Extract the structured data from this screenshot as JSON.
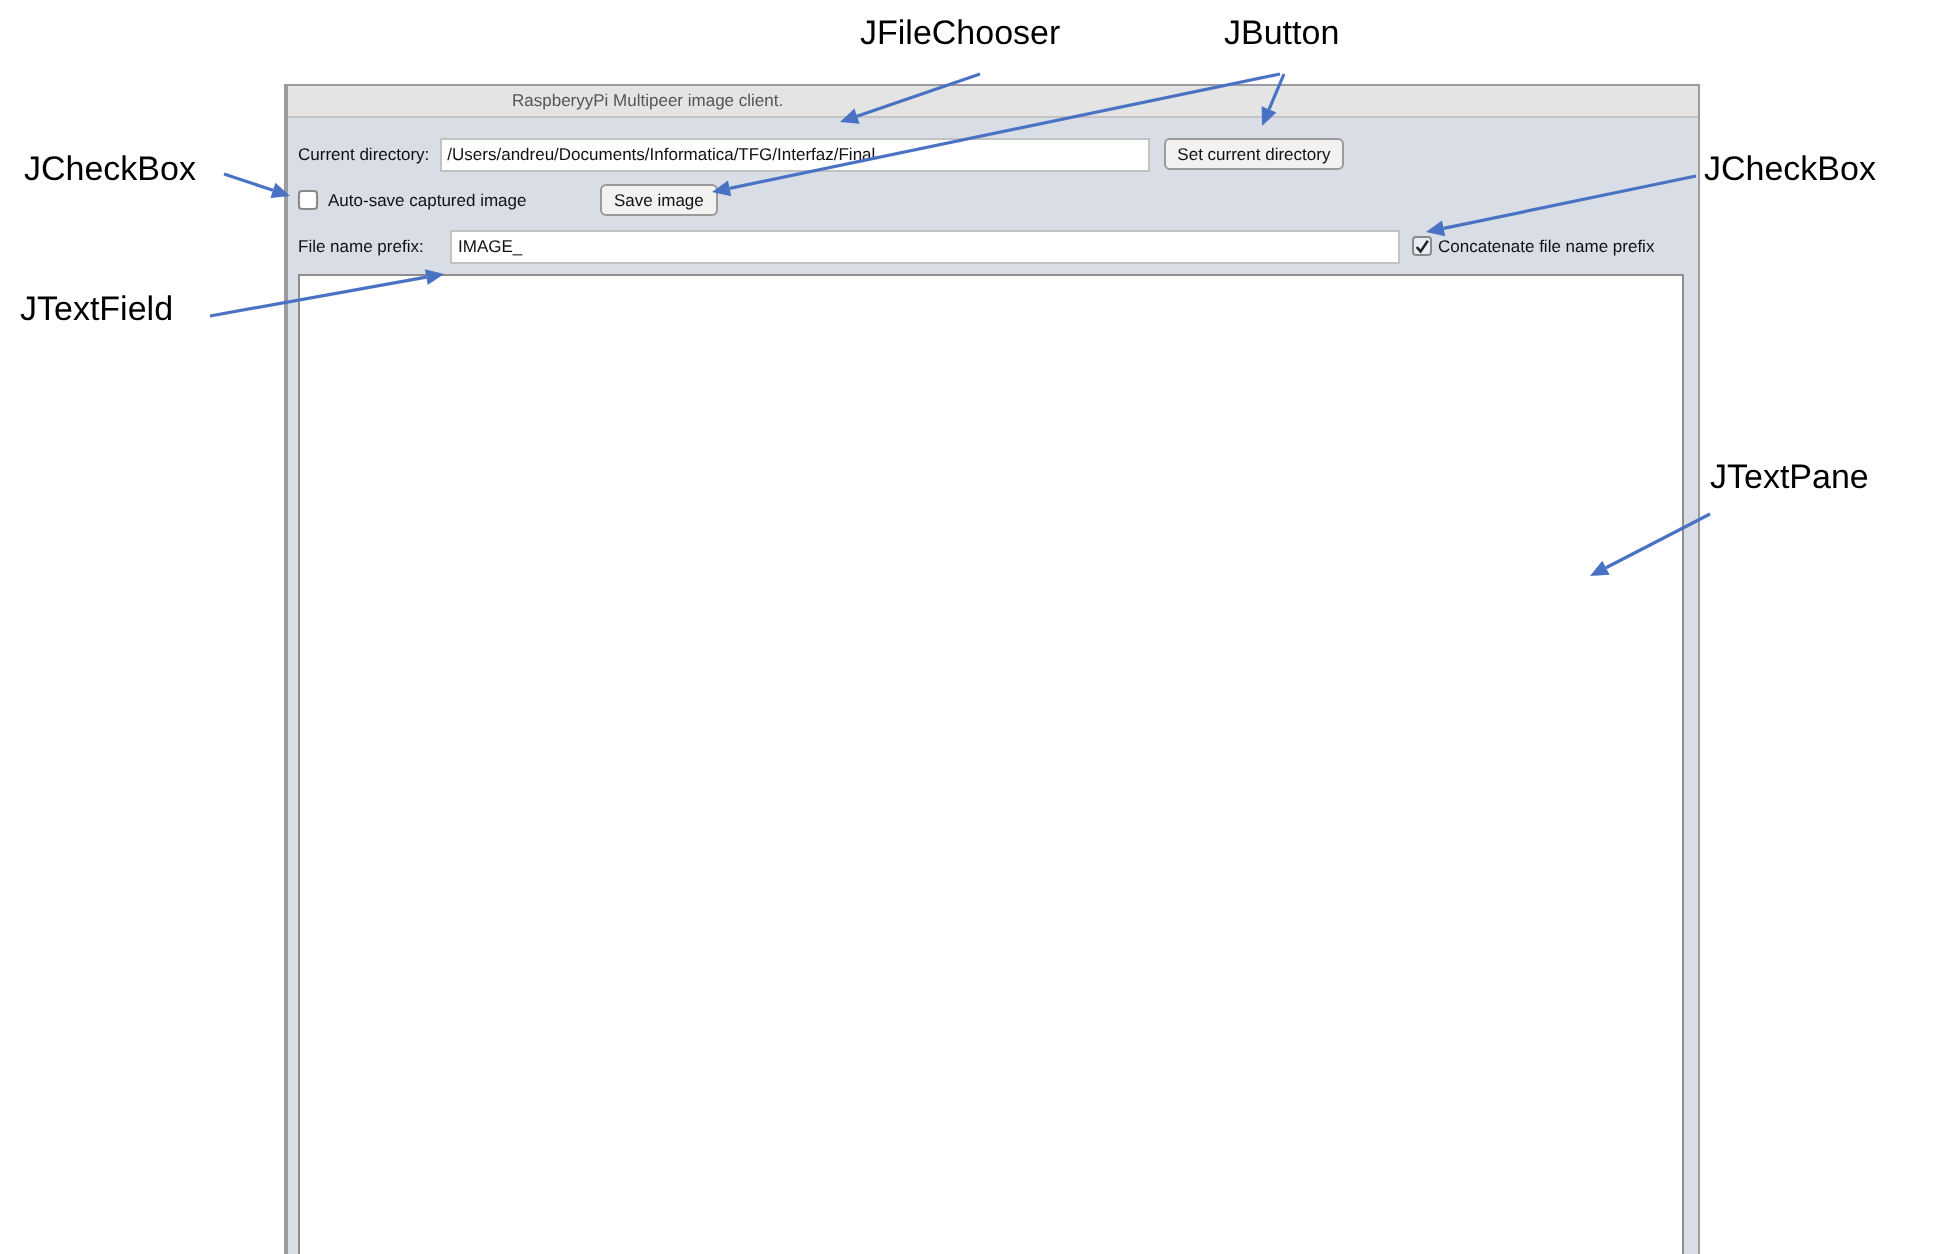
{
  "window": {
    "title": "RaspberyyPi Multipeer image client."
  },
  "directory": {
    "label": "Current directory:",
    "value": "/Users/andreu/Documents/Informatica/TFG/Interfaz/Final",
    "button": "Set current directory"
  },
  "auto_save": {
    "label": "Auto-save captured image",
    "checked": false
  },
  "save_button": "Save image",
  "prefix": {
    "label": "File name prefix:",
    "value": "IMAGE_"
  },
  "concatenate": {
    "label": "Concatenate file name prefix",
    "checked": true
  },
  "annotations": [
    {
      "label": "JFileChooser"
    },
    {
      "label": "JButton"
    },
    {
      "label": "JCheckBox"
    },
    {
      "label": "JCheckBox"
    },
    {
      "label": "JTextField"
    },
    {
      "label": "JTextPane"
    }
  ]
}
